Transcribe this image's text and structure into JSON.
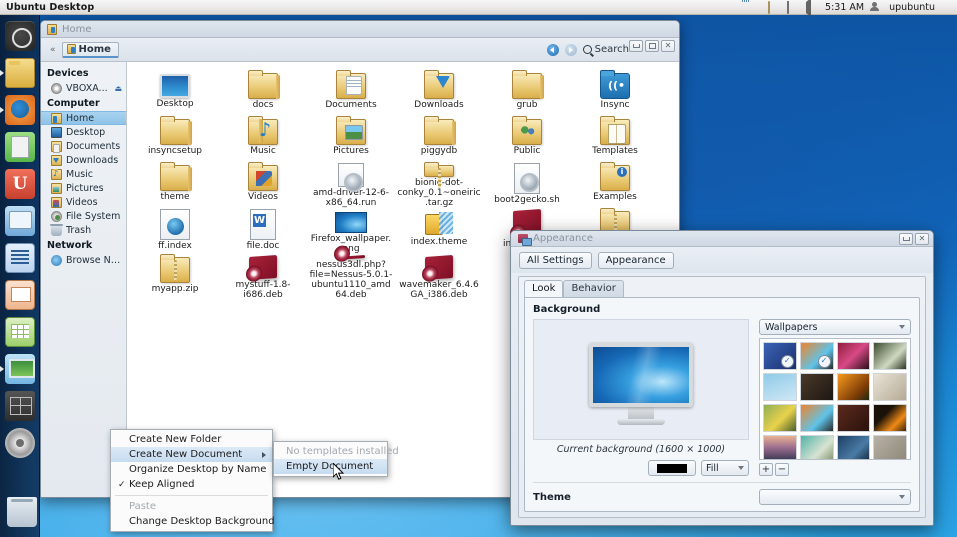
{
  "top_panel": {
    "title": "Ubuntu Desktop",
    "clock": "5:31 AM",
    "user": "upubuntu",
    "icons": [
      "system-monitor-graph-icon",
      "envelope-icon",
      "cart-icon",
      "volume-icon",
      "user-icon",
      "session-icon"
    ]
  },
  "launcher": {
    "items": [
      {
        "name": "ubuntu-dash-icon",
        "cls": "li-ubuntu",
        "label": "",
        "running": false
      },
      {
        "name": "files-icon",
        "cls": "li-files",
        "label": "",
        "running": true
      },
      {
        "name": "firefox-icon",
        "cls": "li-firefox",
        "label": "",
        "running": true
      },
      {
        "name": "ubuntu-help-icon",
        "cls": "li-help",
        "label": "",
        "running": false
      },
      {
        "name": "ubuntu-software-center-icon",
        "cls": "li-ubuntusw",
        "label": "U",
        "running": false
      },
      {
        "name": "system-settings-icon",
        "cls": "li-settings",
        "label": "",
        "running": false
      },
      {
        "name": "libreoffice-writer-icon",
        "cls": "li-writer",
        "label": "",
        "running": false
      },
      {
        "name": "libreoffice-impress-icon",
        "cls": "li-impress",
        "label": "",
        "running": false
      },
      {
        "name": "libreoffice-calc-icon",
        "cls": "li-calc",
        "label": "",
        "running": false
      },
      {
        "name": "displays-icon",
        "cls": "li-displays",
        "label": "",
        "running": true
      },
      {
        "name": "workspace-switcher-icon",
        "cls": "li-workspace",
        "label": "",
        "running": false
      },
      {
        "name": "cd-drive-icon",
        "cls": "li-cd",
        "label": "",
        "running": false
      }
    ],
    "trash": {
      "name": "trash-icon",
      "cls": "li-trash"
    }
  },
  "file_manager": {
    "title": "Home",
    "pathbar": {
      "collapse": "«",
      "current": "Home"
    },
    "search_label": "Search",
    "window_buttons": {
      "minimize": "",
      "maximize": "",
      "close": "✕"
    },
    "sidebar": {
      "groups": [
        {
          "heading": "Devices",
          "items": [
            {
              "label": "VBOXA...",
              "icon": "ic-disc",
              "eject": "⏏",
              "selected": false
            }
          ]
        },
        {
          "heading": "Computer",
          "items": [
            {
              "label": "Home",
              "icon": "ic-folder ic-home",
              "selected": true
            },
            {
              "label": "Desktop",
              "icon": "ic-monitor",
              "selected": false
            },
            {
              "label": "Documents",
              "icon": "ic-folder ic-docs",
              "selected": false
            },
            {
              "label": "Downloads",
              "icon": "ic-folder ic-dl",
              "selected": false
            },
            {
              "label": "Music",
              "icon": "ic-folder ic-music",
              "selected": false
            },
            {
              "label": "Pictures",
              "icon": "ic-folder ic-pics",
              "selected": false
            },
            {
              "label": "Videos",
              "icon": "ic-folder ic-vids",
              "selected": false
            },
            {
              "label": "File System",
              "icon": "ic-fs",
              "selected": false
            },
            {
              "label": "Trash",
              "icon": "ic-trash",
              "selected": false
            }
          ]
        },
        {
          "heading": "Network",
          "items": [
            {
              "label": "Browse Net...",
              "icon": "ic-net",
              "selected": false
            }
          ]
        }
      ]
    },
    "files": [
      {
        "label": "Desktop",
        "glyph": "g-monitor"
      },
      {
        "label": "docs",
        "glyph": "g-folder"
      },
      {
        "label": "Documents",
        "glyph": "g-folder g-docsf"
      },
      {
        "label": "Downloads",
        "glyph": "g-folder g-dl"
      },
      {
        "label": "grub",
        "glyph": "g-folder"
      },
      {
        "label": "Insync",
        "glyph": "g-insync"
      },
      {
        "label": "insyncsetup",
        "glyph": "g-folder"
      },
      {
        "label": "Music",
        "glyph": "g-folder g-music"
      },
      {
        "label": "Pictures",
        "glyph": "g-folder g-pics"
      },
      {
        "label": "piggydb",
        "glyph": "g-folder"
      },
      {
        "label": "Public",
        "glyph": "g-folder g-pub"
      },
      {
        "label": "Templates",
        "glyph": "g-folder g-tmpl"
      },
      {
        "label": "theme",
        "glyph": "g-folder"
      },
      {
        "label": "Videos",
        "glyph": "g-folder g-vids"
      },
      {
        "label": "amd-driver-12-6-x86_64.run",
        "glyph": "g-run"
      },
      {
        "label": "bionic-dot-conky_0.1~oneiric.tar.gz",
        "glyph": "g-folder g-zipfolder"
      },
      {
        "label": "boot2gecko.sh",
        "glyph": "g-run"
      },
      {
        "label": "Examples",
        "glyph": "g-folder g-examples"
      },
      {
        "label": "ff.index",
        "glyph": "g-ff"
      },
      {
        "label": "file.doc",
        "glyph": "g-doc"
      },
      {
        "label": "Firefox_wallpaper.png",
        "glyph": "g-wall"
      },
      {
        "label": "index.theme",
        "glyph": "g-theme"
      },
      {
        "label": "index.html",
        "glyph": "g-deb"
      },
      {
        "label": "",
        "glyph": "g-folder g-zipfolder"
      },
      {
        "label": "myapp.zip",
        "glyph": "g-folder g-zipfolder"
      },
      {
        "label": "mystuff-1.8-i686.deb",
        "glyph": "g-deb"
      },
      {
        "label": "nessus3dl.php?file=Nessus-5.0.1-ubuntu1110_amd64.deb",
        "glyph": "g-deb"
      },
      {
        "label": "wavemaker_6.4.6GA_i386.deb",
        "glyph": "g-deb"
      },
      {
        "label": "",
        "glyph": ""
      },
      {
        "label": "",
        "glyph": ""
      }
    ]
  },
  "context_menu": {
    "items": [
      {
        "label": "Create New Folder",
        "state": "normal",
        "submenu": false,
        "check": false
      },
      {
        "label": "Create New Document",
        "state": "highlight",
        "submenu": true,
        "check": false
      },
      {
        "label": "Organize Desktop by Name",
        "state": "normal",
        "submenu": false,
        "check": false
      },
      {
        "label": "Keep Aligned",
        "state": "normal",
        "submenu": false,
        "check": true
      },
      {
        "label": "Paste",
        "state": "disabled",
        "submenu": false,
        "check": false
      },
      {
        "label": "Change Desktop Background",
        "state": "normal",
        "submenu": false,
        "check": false
      }
    ],
    "submenu": {
      "items": [
        {
          "label": "No templates installed",
          "state": "disabled"
        },
        {
          "label": "Empty Document",
          "state": "highlight"
        }
      ]
    }
  },
  "appearance": {
    "title": "Appearance",
    "buttons": {
      "all_settings": "All Settings",
      "current": "Appearance"
    },
    "window_buttons": {
      "minimize": "",
      "close": "✕"
    },
    "tabs": [
      {
        "label": "Look",
        "active": true
      },
      {
        "label": "Behavior",
        "active": false
      }
    ],
    "background": {
      "section_title": "Background",
      "caption": "Current background (1600 × 1000)",
      "color_value": "#000000",
      "fill_mode": "Fill",
      "wallpaper_source": "Wallpapers",
      "add_button": "+",
      "remove_button": "−",
      "wallpapers": [
        {
          "name": "ubuntu-default-blue",
          "color": "linear-gradient(135deg,#3c64b6,#1b2f6e)",
          "selected": true
        },
        {
          "name": "orange-abstract-1",
          "color": "linear-gradient(135deg,#f0842c,#5ec3e8 60%,#2a2a2a)",
          "selected": true
        },
        {
          "name": "magenta-petal",
          "color": "linear-gradient(135deg,#8e1f3d,#d84a86 50%,#2b0c18)",
          "selected": false
        },
        {
          "name": "white-blossom-dark",
          "color": "linear-gradient(135deg,#3c4a2e,#cfd8c0 60%,#2d3623)",
          "selected": false
        },
        {
          "name": "blue-sky-birds",
          "color": "linear-gradient(160deg,#8fcbe8,#cfe7f4)",
          "selected": false
        },
        {
          "name": "dark-brown-texture",
          "color": "linear-gradient(135deg,#4a3a2a,#1d1712)",
          "selected": false
        },
        {
          "name": "orange-flower",
          "color": "linear-gradient(135deg,#f79a1e,#7c3b06 70%,#1f2a12)",
          "selected": false
        },
        {
          "name": "white-butterfly",
          "color": "linear-gradient(135deg,#e9e4d8,#b5aa94)",
          "selected": false
        },
        {
          "name": "green-yellow-flower",
          "color": "linear-gradient(135deg,#8fae54,#e8d24b 55%,#4a5e2c)",
          "selected": false
        },
        {
          "name": "orange-abstract-2",
          "color": "linear-gradient(135deg,#f0842c,#5ec3e8 60%,#2a2a2a)",
          "selected": false
        },
        {
          "name": "brown-maroon",
          "color": "linear-gradient(135deg,#5a2a1e,#2b120c)",
          "selected": false
        },
        {
          "name": "orange-vinyl",
          "color": "linear-gradient(135deg,#1a1208 35%,#f08a16 70%,#3a2408)",
          "selected": false
        },
        {
          "name": "sunset-city",
          "color": "linear-gradient(to bottom,#e8b392,#9a6d8f 45%,#2c3149)",
          "selected": false
        },
        {
          "name": "turquoise-water",
          "color": "linear-gradient(135deg,#4fb3a8,#d8e3d2 60%,#7e8f6a)",
          "selected": false
        },
        {
          "name": "blue-fabric",
          "color": "linear-gradient(135deg,#1d3f63,#4a7ba5 60%,#12263c)",
          "selected": false
        },
        {
          "name": "grey-sand",
          "color": "linear-gradient(135deg,#b7b2a5,#8d8679)",
          "selected": false
        }
      ]
    },
    "theme": {
      "label": "Theme",
      "value": ""
    }
  }
}
